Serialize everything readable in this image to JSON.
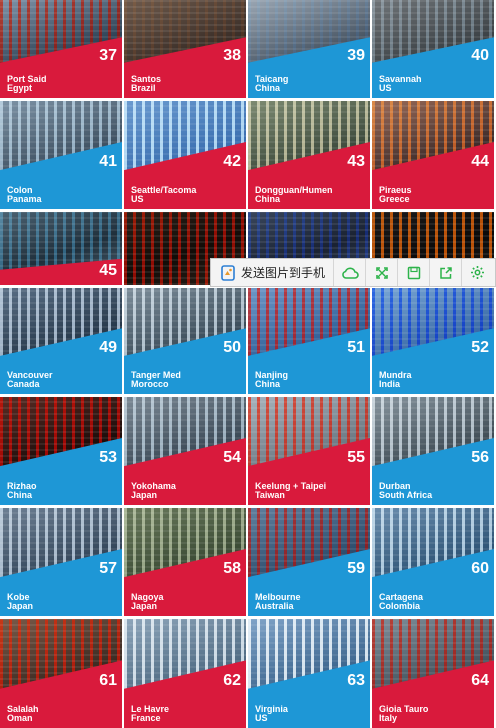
{
  "colors": {
    "red": "#d91a3c",
    "blue": "#1e97d6",
    "toolbar_icon": "#2db34a"
  },
  "ports": [
    {
      "number": "37",
      "name": "Port Said",
      "country": "Egypt",
      "band": "red"
    },
    {
      "number": "38",
      "name": "Santos",
      "country": "Brazil",
      "band": "red"
    },
    {
      "number": "39",
      "name": "Taicang",
      "country": "China",
      "band": "blue"
    },
    {
      "number": "40",
      "name": "Savannah",
      "country": "US",
      "band": "blue"
    },
    {
      "number": "41",
      "name": "Colon",
      "country": "Panama",
      "band": "blue"
    },
    {
      "number": "42",
      "name": "Seattle/Tacoma",
      "country": "US",
      "band": "red"
    },
    {
      "number": "43",
      "name": "Dongguan/Humen",
      "country": "China",
      "band": "red"
    },
    {
      "number": "44",
      "name": "Piraeus",
      "country": "Greece",
      "band": "red"
    },
    {
      "number": "45",
      "name": "",
      "country": "",
      "band": "red"
    },
    {
      "number": "",
      "name": "",
      "country": "",
      "band": "none"
    },
    {
      "number": "",
      "name": "",
      "country": "",
      "band": "none"
    },
    {
      "number": "",
      "name": "",
      "country": "",
      "band": "none"
    },
    {
      "number": "49",
      "name": "Vancouver",
      "country": "Canada",
      "band": "blue"
    },
    {
      "number": "50",
      "name": "Tanger Med",
      "country": "Morocco",
      "band": "blue"
    },
    {
      "number": "51",
      "name": "Nanjing",
      "country": "China",
      "band": "blue"
    },
    {
      "number": "52",
      "name": "Mundra",
      "country": "India",
      "band": "blue"
    },
    {
      "number": "53",
      "name": "Rizhao",
      "country": "China",
      "band": "blue"
    },
    {
      "number": "54",
      "name": "Yokohama",
      "country": "Japan",
      "band": "red"
    },
    {
      "number": "55",
      "name": "Keelung + Taipei",
      "country": "Taiwan",
      "band": "red"
    },
    {
      "number": "56",
      "name": "Durban",
      "country": "South Africa",
      "band": "blue"
    },
    {
      "number": "57",
      "name": "Kobe",
      "country": "Japan",
      "band": "blue"
    },
    {
      "number": "58",
      "name": "Nagoya",
      "country": "Japan",
      "band": "red"
    },
    {
      "number": "59",
      "name": "Melbourne",
      "country": "Australia",
      "band": "blue"
    },
    {
      "number": "60",
      "name": "Cartagena",
      "country": "Colombia",
      "band": "blue"
    },
    {
      "number": "61",
      "name": "Salalah",
      "country": "Oman",
      "band": "red"
    },
    {
      "number": "62",
      "name": "Le Havre",
      "country": "France",
      "band": "red"
    },
    {
      "number": "63",
      "name": "Virginia",
      "country": "US",
      "band": "blue"
    },
    {
      "number": "64",
      "name": "Gioia Tauro",
      "country": "Italy",
      "band": "red"
    }
  ],
  "toolbar": {
    "send_label": "发送图片到手机",
    "buttons": [
      "cloud-icon",
      "expand-icon",
      "save-icon",
      "share-icon",
      "settings-icon"
    ]
  }
}
